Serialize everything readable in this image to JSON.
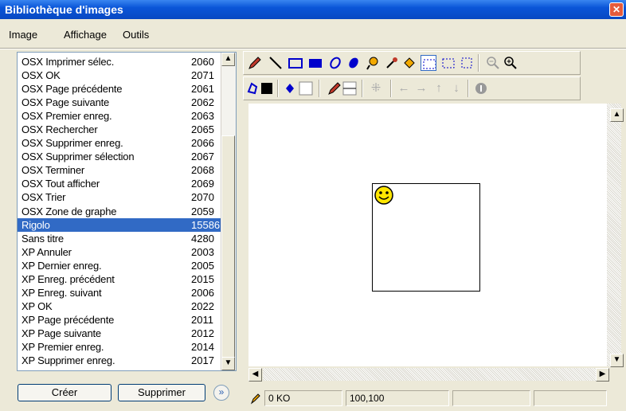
{
  "window": {
    "title": "Bibliothèque d'images",
    "close_glyph": "✕"
  },
  "menu": [
    "Image",
    "Affichage",
    "Outils"
  ],
  "list": {
    "items": [
      {
        "name": "OSX Imprimer sélec.",
        "id": "2060"
      },
      {
        "name": "OSX OK",
        "id": "2071"
      },
      {
        "name": "OSX Page précédente",
        "id": "2061"
      },
      {
        "name": "OSX Page suivante",
        "id": "2062"
      },
      {
        "name": "OSX Premier enreg.",
        "id": "2063"
      },
      {
        "name": "OSX Rechercher",
        "id": "2065"
      },
      {
        "name": "OSX Supprimer enreg.",
        "id": "2066"
      },
      {
        "name": "OSX Supprimer sélection",
        "id": "2067"
      },
      {
        "name": "OSX Terminer",
        "id": "2068"
      },
      {
        "name": "OSX Tout afficher",
        "id": "2069"
      },
      {
        "name": "OSX Trier",
        "id": "2070"
      },
      {
        "name": "OSX Zone de graphe",
        "id": "2059"
      },
      {
        "name": "Rigolo",
        "id": "15586"
      },
      {
        "name": "Sans titre",
        "id": "4280"
      },
      {
        "name": "XP Annuler",
        "id": "2003"
      },
      {
        "name": "XP Dernier enreg.",
        "id": "2005"
      },
      {
        "name": "XP Enreg. précédent",
        "id": "2015"
      },
      {
        "name": "XP Enreg. suivant",
        "id": "2006"
      },
      {
        "name": "XP OK",
        "id": "2022"
      },
      {
        "name": "XP Page précédente",
        "id": "2011"
      },
      {
        "name": "XP Page suivante",
        "id": "2012"
      },
      {
        "name": "XP Premier enreg.",
        "id": "2014"
      },
      {
        "name": "XP Supprimer enreg.",
        "id": "2017"
      }
    ],
    "selected": "Rigolo",
    "selection_color": "#316ac5"
  },
  "buttons": {
    "create": "Créer",
    "delete": "Supprimer",
    "more": "»"
  },
  "tools_row1": [
    "pencil-icon",
    "line-icon",
    "rectangle-icon",
    "filled-rectangle-icon",
    "ellipse-icon",
    "filled-ellipse-icon",
    "lasso-fill-icon",
    "eyedropper-icon",
    "paint-bucket-icon",
    "select-rect-icon",
    "select-resize-icon",
    "select-free-icon",
    "zoom-out-icon",
    "zoom-in-icon"
  ],
  "tools_row2": [
    "stroke-color-icon",
    "fill-color-icon",
    "line-color-icon",
    "line-width-icon",
    "grid-icon",
    "arrow-left-icon",
    "arrow-right-icon",
    "arrow-up-icon",
    "arrow-down-icon",
    "stop-icon"
  ],
  "status": {
    "size": "0 KO",
    "coords": "100,100"
  }
}
